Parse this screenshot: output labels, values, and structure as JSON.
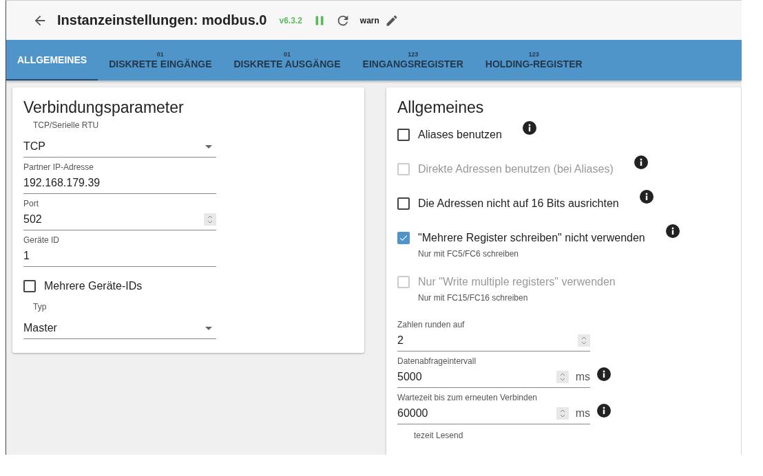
{
  "header": {
    "title": "Instanzeinstellungen: modbus.0",
    "version": "v6.3.2",
    "log_level": "warn"
  },
  "tabs": [
    {
      "label": "ALLGEMEINES",
      "selected": true
    },
    {
      "label": "DISKRETE EINGÄNGE",
      "badge": "01",
      "selected": false
    },
    {
      "label": "DISKRETE AUSGÄNGE",
      "badge": "01",
      "selected": false
    },
    {
      "label": "EINGANGSREGISTER",
      "badge": "123",
      "selected": false
    },
    {
      "label": "HOLDING-REGISTER",
      "badge": "123",
      "selected": false
    }
  ],
  "connection_panel": {
    "title": "Verbindungsparameter",
    "fields": [
      {
        "kind": "select",
        "label": "TCP/Serielle RTU",
        "value": "TCP"
      },
      {
        "kind": "text",
        "label": "Partner IP-Adresse",
        "value": "192.168.179.39"
      },
      {
        "kind": "number",
        "label": "Port",
        "value": "502"
      },
      {
        "kind": "text",
        "label": "Geräte ID",
        "value": "1"
      },
      {
        "kind": "checkbox",
        "label": "Mehrere Geräte-IDs",
        "checked": false
      },
      {
        "kind": "select",
        "label": "Typ",
        "value": "Master"
      }
    ]
  },
  "general_panel": {
    "title": "Allgemeines",
    "options": [
      {
        "label": "Aliases benutzen",
        "checked": false,
        "disabled": false,
        "info": true
      },
      {
        "label": "Direkte Adressen benutzen (bei Aliases)",
        "checked": false,
        "disabled": true,
        "info": true
      },
      {
        "label": "Die Adressen nicht auf 16 Bits ausrichten",
        "checked": false,
        "disabled": false,
        "info": true
      },
      {
        "label": "\"Mehrere Register schreiben\" nicht verwenden",
        "checked": true,
        "disabled": false,
        "info": true,
        "hint": "Nur mit FC5/FC6 schreiben"
      },
      {
        "label": "Nur \"Write multiple registers\" verwenden",
        "checked": false,
        "disabled": true,
        "info": false,
        "hint": "Nur mit FC15/FC16 schreiben"
      }
    ],
    "fields": [
      {
        "label": "Zahlen runden auf",
        "value": "2",
        "info": false
      },
      {
        "label": "Datenabfrageintervall",
        "value": "5000",
        "unit": "ms",
        "info": true
      },
      {
        "label": "Wartezeit bis zum erneuten Verbinden",
        "value": "60000",
        "unit": "ms",
        "info": true
      }
    ],
    "cut_label": "tezeit Lesend"
  }
}
